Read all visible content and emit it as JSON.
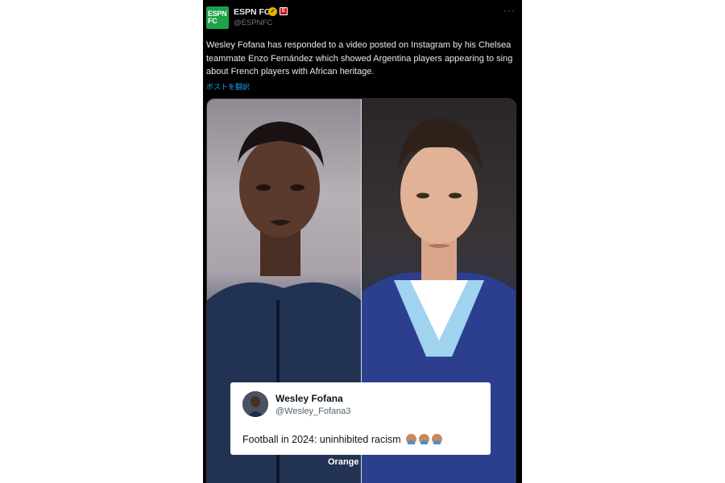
{
  "tweet": {
    "account": {
      "logo_text_line1": "ESPN",
      "logo_text_line2": "FC",
      "name": "ESPN FC",
      "handle": "@ESPNFC",
      "verified_icon": "gold-checkmark-icon",
      "affiliate_badge_icon": "espn-affiliate-badge-icon",
      "affiliate_badge_text": "E"
    },
    "more_icon": "more-horizontal-icon",
    "more_glyph": "···",
    "text": "Wesley Fofana has responded to a video posted on Instagram by his Chelsea teammate Enzo Fernández which showed Argentina players appearing to sing about French players with African heritage.",
    "translate_label": "ポストを翻訳",
    "media": {
      "left_photo": "wesley-fofana-portrait",
      "right_photo": "enzo-fernandez-portrait",
      "jersey_sponsor_text": "Orange",
      "quote": {
        "name": "Wesley Fofana",
        "handle": "@Wesley_Fofana3",
        "text": "Football in 2024: uninhibited racism",
        "emoji_count": 3
      }
    }
  },
  "colors": {
    "background": "#000000",
    "text": "#e7e9ea",
    "secondary_text": "#71767b",
    "link": "#1d9bf0",
    "espn_fc_green": "#1fa04a",
    "verified_gold": "#e8b200"
  }
}
